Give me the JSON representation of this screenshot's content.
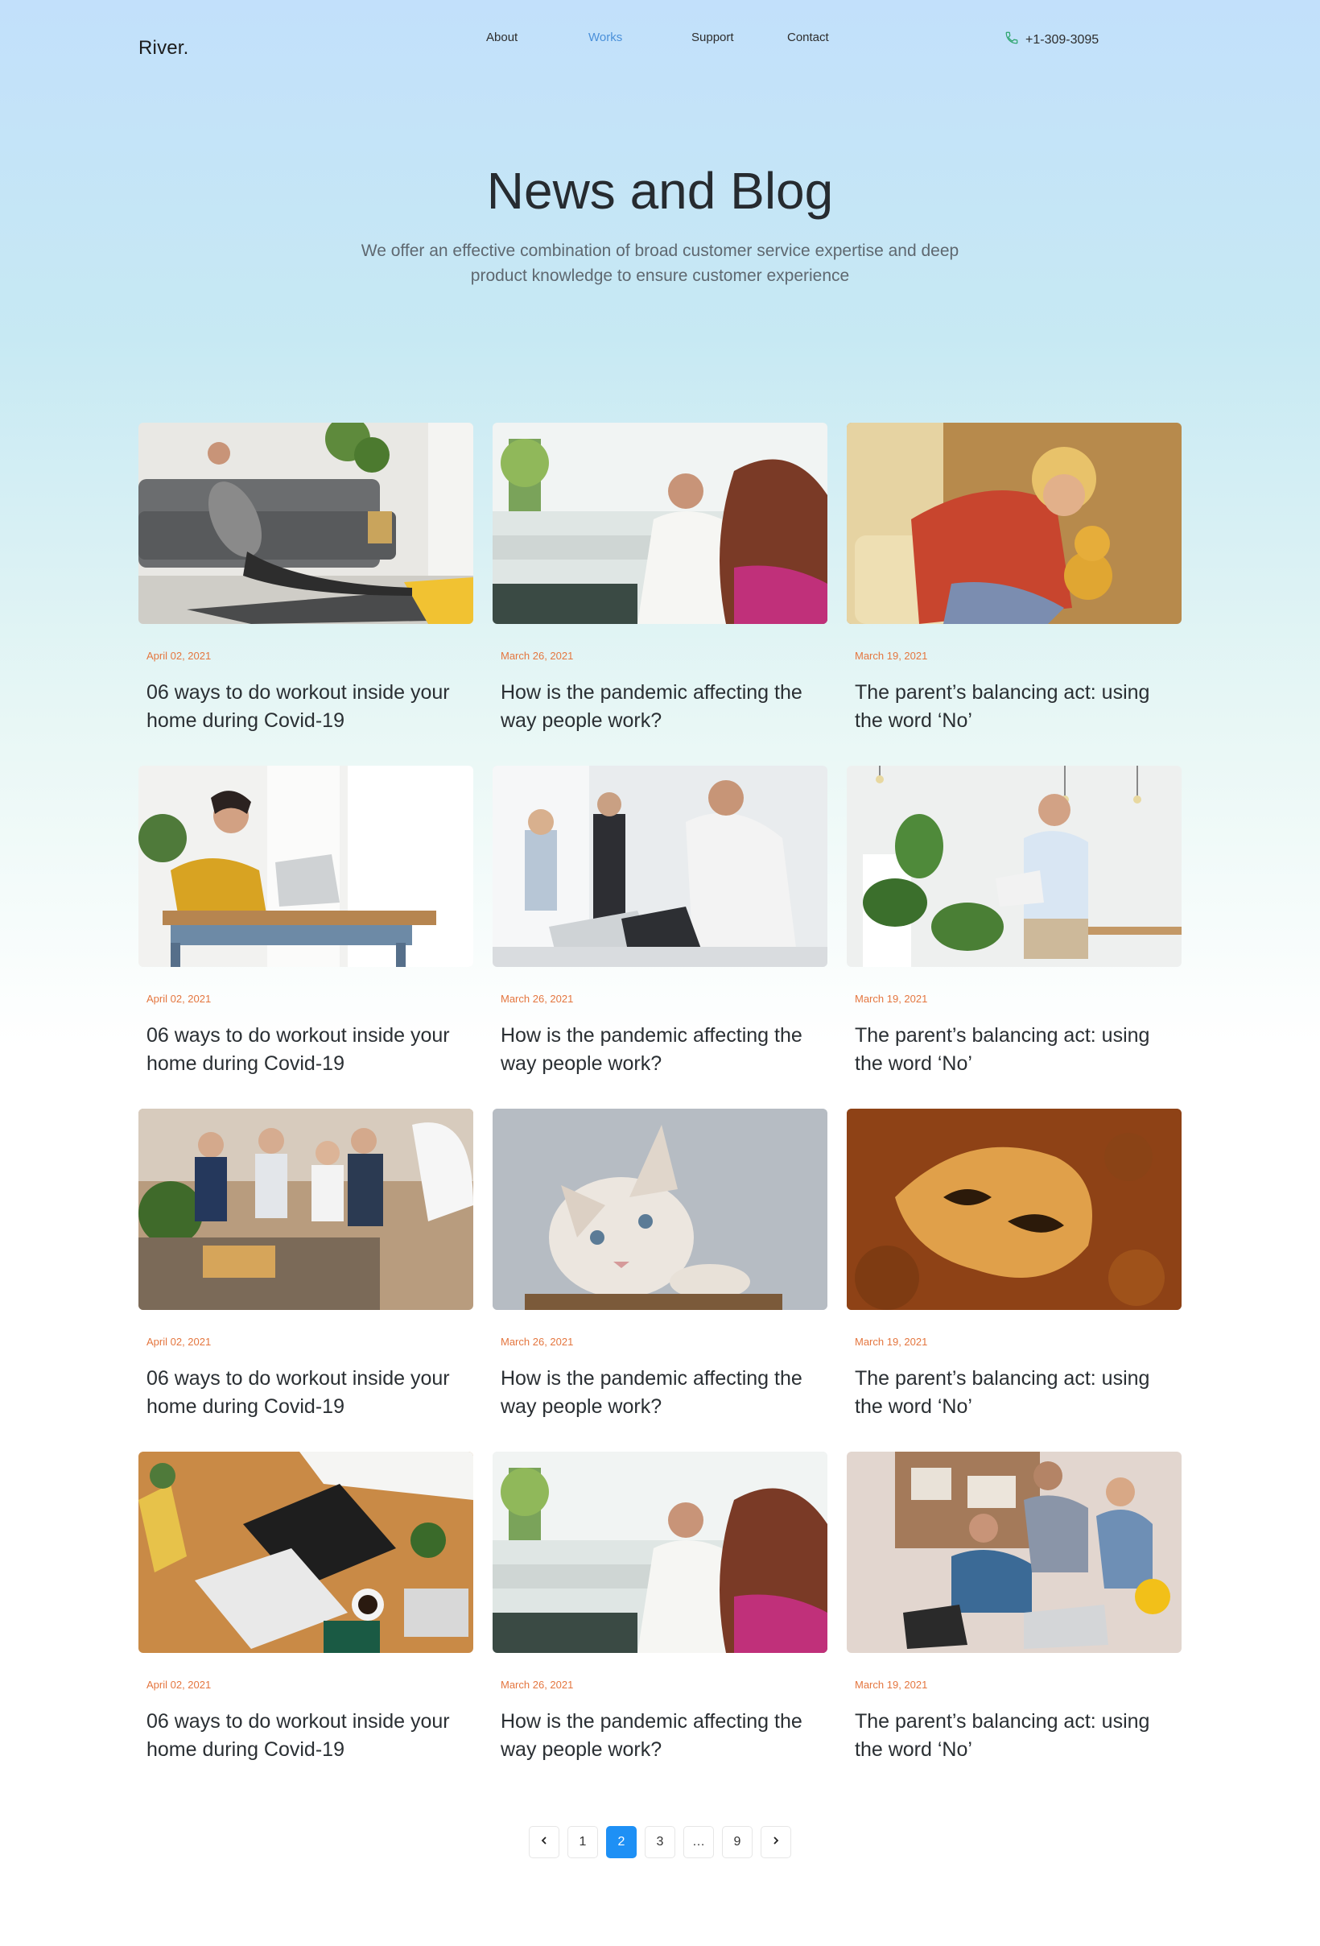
{
  "header": {
    "logo": "River.",
    "nav": [
      {
        "label": "About",
        "active": false
      },
      {
        "label": "Works",
        "active": true
      },
      {
        "label": "Support",
        "active": false
      },
      {
        "label": "Contact",
        "active": false
      }
    ],
    "phone": "+1-309-3095",
    "phone_icon": "phone-icon",
    "accent_color": "#4a90d9"
  },
  "hero": {
    "title": "News and Blog",
    "subtitle": "We offer an effective combination of broad customer service expertise and deep product knowledge to ensure customer experience"
  },
  "posts": [
    {
      "date": "April 02, 2021",
      "title": "06 ways to do workout inside your home during Covid-19",
      "image": "yoga-stretch-photo"
    },
    {
      "date": "March 26, 2021",
      "title": "How is the pandemic affecting the way people work?",
      "image": "office-colleagues-photo"
    },
    {
      "date": "March 19, 2021",
      "title": "The parent’s balancing act: using the word ‘No’",
      "image": "tired-woman-teddy-photo"
    },
    {
      "date": "April 02, 2021",
      "title": "06 ways to do workout inside your home during Covid-19",
      "image": "woman-laptop-desk-photo"
    },
    {
      "date": "March 26, 2021",
      "title": "How is the pandemic affecting the way people work?",
      "image": "team-meeting-photo"
    },
    {
      "date": "March 19, 2021",
      "title": "The parent’s balancing act: using the word ‘No’",
      "image": "man-laptop-office-photo"
    },
    {
      "date": "April 02, 2021",
      "title": "06 ways to do workout inside your home during Covid-19",
      "image": "business-party-photo"
    },
    {
      "date": "March 26, 2021",
      "title": "How is the pandemic affecting the way people work?",
      "image": "kitten-photo"
    },
    {
      "date": "March 19, 2021",
      "title": "The parent’s balancing act: using the word ‘No’",
      "image": "golden-mask-photo"
    },
    {
      "date": "April 02, 2021",
      "title": "06 ways to do workout inside your home during Covid-19",
      "image": "desk-top-view-photo"
    },
    {
      "date": "March 26, 2021",
      "title": "How is the pandemic affecting the way people work?",
      "image": "office-colleagues-photo"
    },
    {
      "date": "March 19, 2021",
      "title": "The parent’s balancing act: using the word ‘No’",
      "image": "group-laptop-photo"
    }
  ],
  "date_color": "#e4763f",
  "pagination": {
    "prev_icon": "chevron-left-icon",
    "next_icon": "chevron-right-icon",
    "pages": [
      "1",
      "2",
      "3",
      "…",
      "9"
    ],
    "current": "2",
    "active_color": "#1e90f5"
  }
}
